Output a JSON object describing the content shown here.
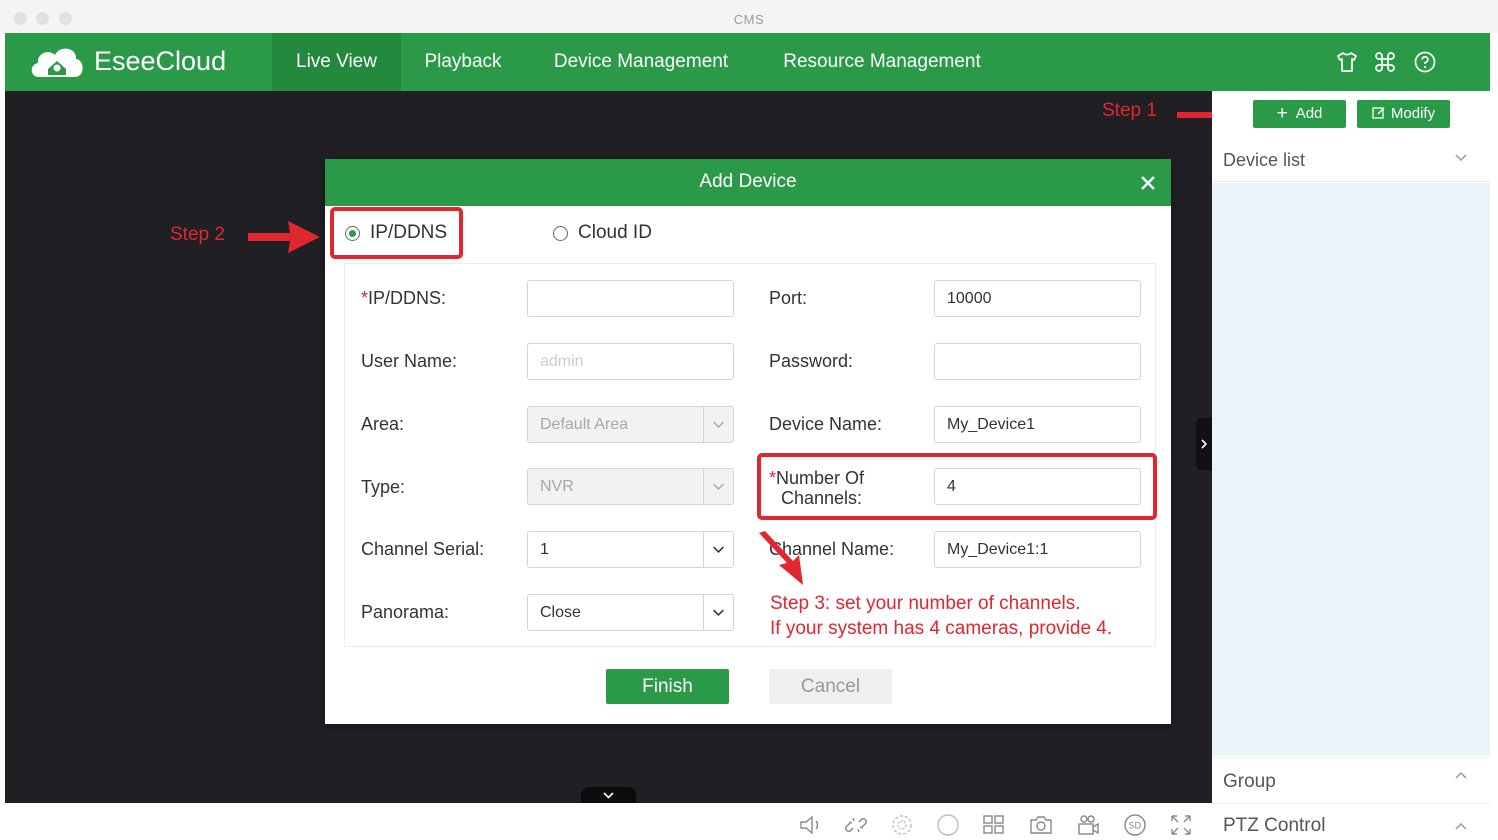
{
  "window": {
    "title": "CMS"
  },
  "navbar": {
    "brand": "EseeCloud",
    "items": [
      {
        "label": "Live View",
        "active": true
      },
      {
        "label": "Playback",
        "active": false
      },
      {
        "label": "Device Management",
        "active": false
      },
      {
        "label": "Resource Management",
        "active": false
      }
    ],
    "icons": [
      "shirt-icon",
      "command-icon",
      "help-icon"
    ]
  },
  "annotations": {
    "step1": "Step 1",
    "step2": "Step 2",
    "step3_line1": "Step 3: set your number of channels.",
    "step3_line2": "If your system has 4 cameras, provide 4."
  },
  "right_panel": {
    "add_label": "Add",
    "modify_label": "Modify",
    "device_list_title": "Device list",
    "group_title": "Group",
    "ptz_title": "PTZ Control"
  },
  "dialog": {
    "title": "Add Device",
    "modes": [
      {
        "label": "IP/DDNS",
        "selected": true
      },
      {
        "label": "Cloud ID",
        "selected": false
      }
    ],
    "fields": {
      "ip_label": "IP/DDNS:",
      "ip_value": "",
      "port_label": "Port:",
      "port_value": "10000",
      "username_label": "User Name:",
      "username_placeholder": "admin",
      "password_label": "Password:",
      "password_value": "",
      "area_label": "Area:",
      "area_value": "Default Area",
      "device_name_label": "Device Name:",
      "device_name_value": "My_Device1",
      "type_label": "Type:",
      "type_value": "NVR",
      "channels_label_1": "Number Of",
      "channels_label_2": "Channels:",
      "channels_value": "4",
      "channel_serial_label": "Channel Serial:",
      "channel_serial_value": "1",
      "channel_name_label": "Channel Name:",
      "channel_name_value": "My_Device1:1",
      "panorama_label": "Panorama:",
      "panorama_value": "Close"
    },
    "finish_label": "Finish",
    "cancel_label": "Cancel"
  },
  "colors": {
    "brand_green": "#2a9a48",
    "annotation_red": "#e0262f",
    "viewport_bg": "#1f1f24"
  }
}
